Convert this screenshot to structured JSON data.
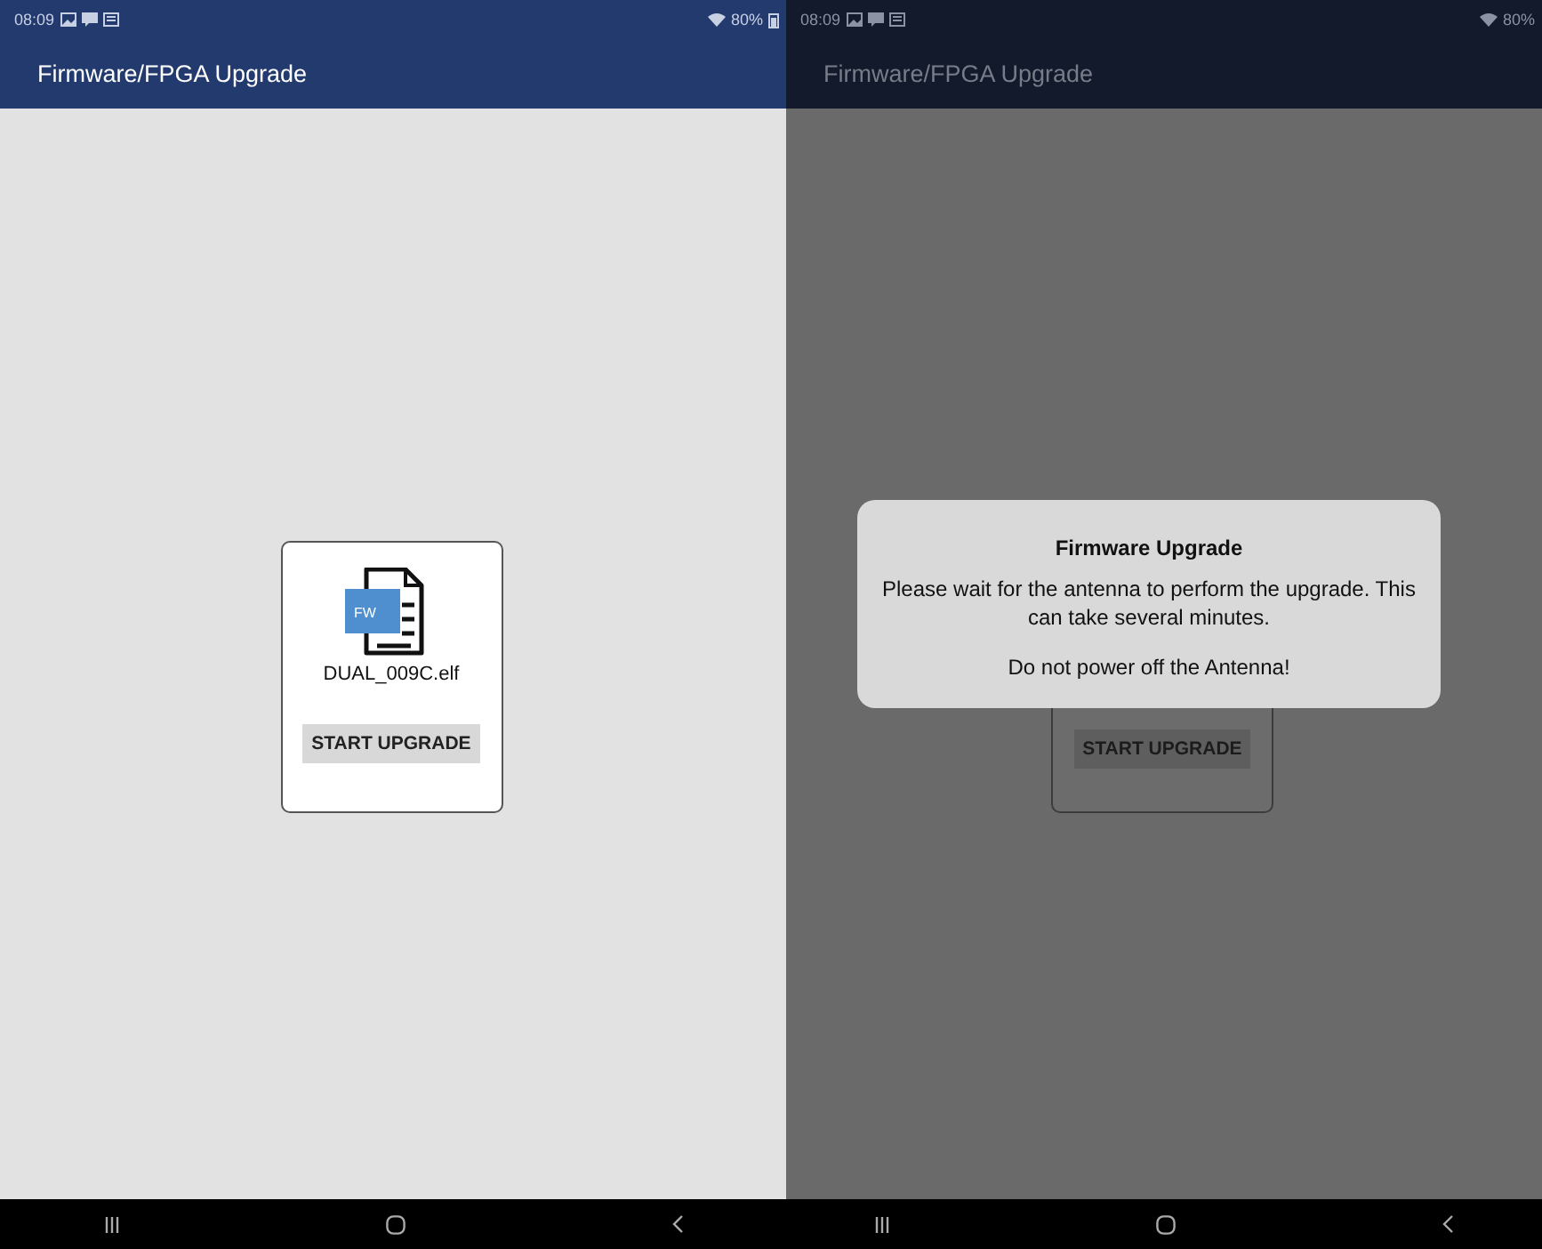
{
  "screens": [
    {
      "dimmed": false,
      "status_bar": {
        "time": "08:09",
        "battery": "80%",
        "battery_icon": true
      },
      "app_bar": {
        "title": "Firmware/FPGA Upgrade"
      },
      "card": {
        "icon_label": "FW",
        "file_name": "DUAL_009C.elf",
        "button": "START UPGRADE"
      }
    },
    {
      "dimmed": true,
      "status_bar": {
        "time": "08:09",
        "battery": "80%",
        "battery_icon": false
      },
      "app_bar": {
        "title": "Firmware/FPGA Upgrade"
      },
      "card": {
        "button": "START UPGRADE"
      },
      "dialog": {
        "title": "Firmware Upgrade",
        "message": "Please wait for the antenna to perform the upgrade. This can take several minutes.",
        "warning": "Do not power off the Antenna!"
      }
    }
  ]
}
